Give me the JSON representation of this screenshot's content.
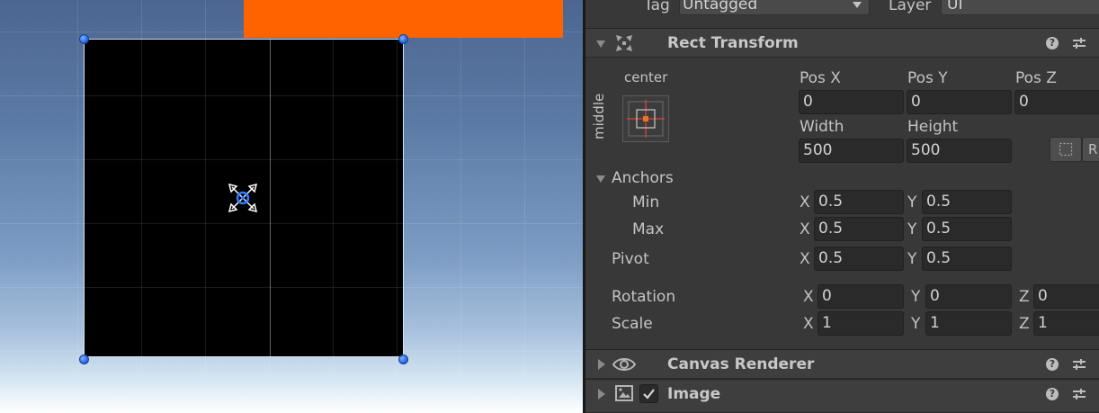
{
  "inspector": {
    "tag_label": "Tag",
    "tag_value": "Untagged",
    "layer_label": "Layer",
    "layer_value": "UI",
    "rect_transform": {
      "title": "Rect Transform",
      "anchor_preset_h": "center",
      "anchor_preset_v": "middle",
      "pos_x_label": "Pos X",
      "pos_y_label": "Pos Y",
      "pos_z_label": "Pos Z",
      "pos_x": "0",
      "pos_y": "0",
      "pos_z": "0",
      "width_label": "Width",
      "height_label": "Height",
      "width": "500",
      "height": "500",
      "raw_button": "R",
      "anchors_label": "Anchors",
      "min_label": "Min",
      "max_label": "Max",
      "pivot_label": "Pivot",
      "x_label": "X",
      "y_label": "Y",
      "z_label": "Z",
      "min_x": "0.5",
      "min_y": "0.5",
      "max_x": "0.5",
      "max_y": "0.5",
      "pivot_x": "0.5",
      "pivot_y": "0.5",
      "rotation_label": "Rotation",
      "rotation_x": "0",
      "rotation_y": "0",
      "rotation_z": "0",
      "scale_label": "Scale",
      "scale_x": "1",
      "scale_y": "1",
      "scale_z": "1"
    },
    "canvas_renderer": {
      "title": "Canvas Renderer"
    },
    "image": {
      "title": "Image",
      "enabled": true
    },
    "help_glyph": "?"
  },
  "colors": {
    "orange_panel": "#ff6300",
    "rect_fill": "#000000",
    "handle": "#1d5fe0",
    "inspector_bg": "#383838"
  },
  "icons": [
    "dropdown-arrow-icon",
    "rect-transform-icon",
    "anchor-preset-icon",
    "help-icon",
    "preset-icon",
    "eye-icon",
    "image-icon",
    "checkbox-icon",
    "blueprint-mode-icon",
    "pivot-gizmo-icon"
  ]
}
